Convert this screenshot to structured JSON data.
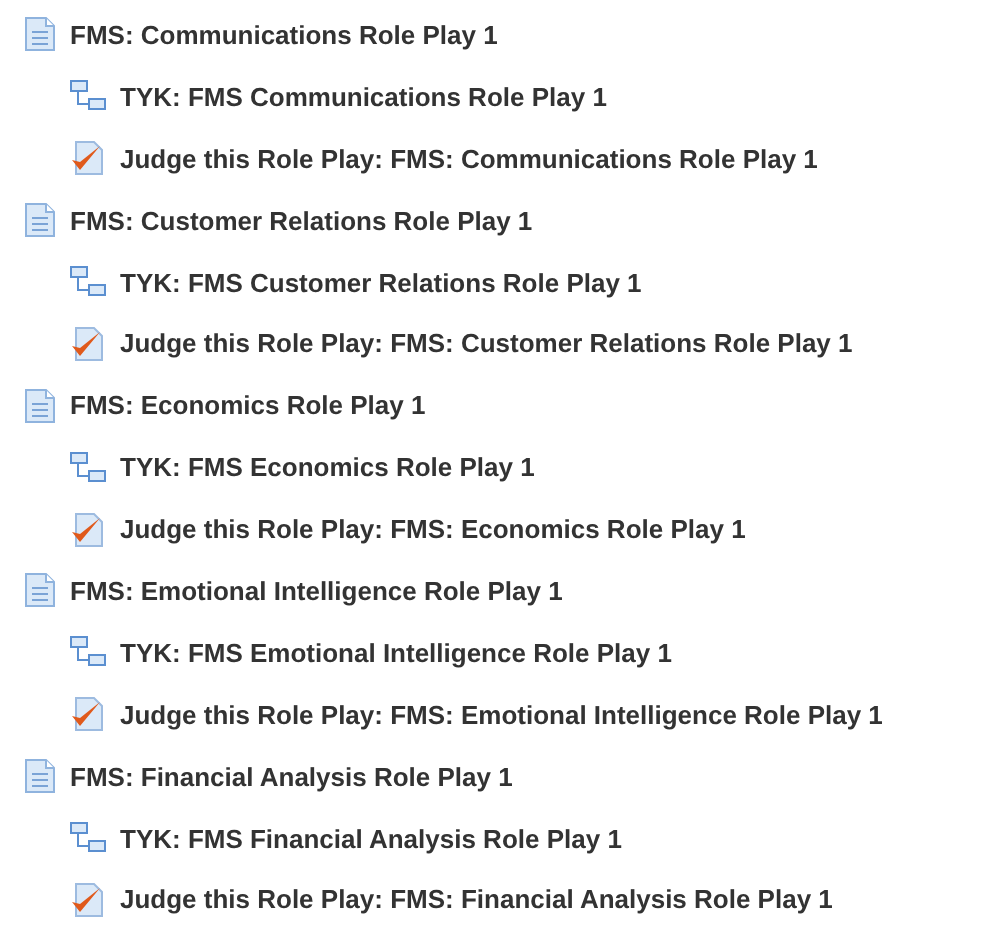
{
  "sections": [
    {
      "title": "FMS: Communications Role Play 1",
      "items": [
        {
          "kind": "tree",
          "label": "TYK: FMS Communications Role Play 1"
        },
        {
          "kind": "check",
          "label": "Judge this Role Play: FMS: Communications Role Play 1"
        }
      ]
    },
    {
      "title": "FMS: Customer Relations Role Play 1",
      "items": [
        {
          "kind": "tree",
          "label": "TYK: FMS Customer Relations Role Play 1"
        },
        {
          "kind": "check",
          "label": "Judge this Role Play: FMS: Customer Relations Role Play 1"
        }
      ]
    },
    {
      "title": "FMS: Economics Role Play 1",
      "items": [
        {
          "kind": "tree",
          "label": "TYK: FMS Economics Role Play 1"
        },
        {
          "kind": "check",
          "label": "Judge this Role Play: FMS: Economics Role Play 1"
        }
      ]
    },
    {
      "title": "FMS: Emotional Intelligence Role Play 1",
      "items": [
        {
          "kind": "tree",
          "label": "TYK: FMS Emotional Intelligence Role Play 1"
        },
        {
          "kind": "check",
          "label": "Judge this Role Play: FMS: Emotional Intelligence Role Play 1"
        }
      ]
    },
    {
      "title": "FMS: Financial Analysis Role Play 1",
      "items": [
        {
          "kind": "tree",
          "label": "TYK: FMS Financial Analysis Role Play 1"
        },
        {
          "kind": "check",
          "label": "Judge this Role Play: FMS: Financial Analysis Role Play 1"
        }
      ]
    }
  ]
}
